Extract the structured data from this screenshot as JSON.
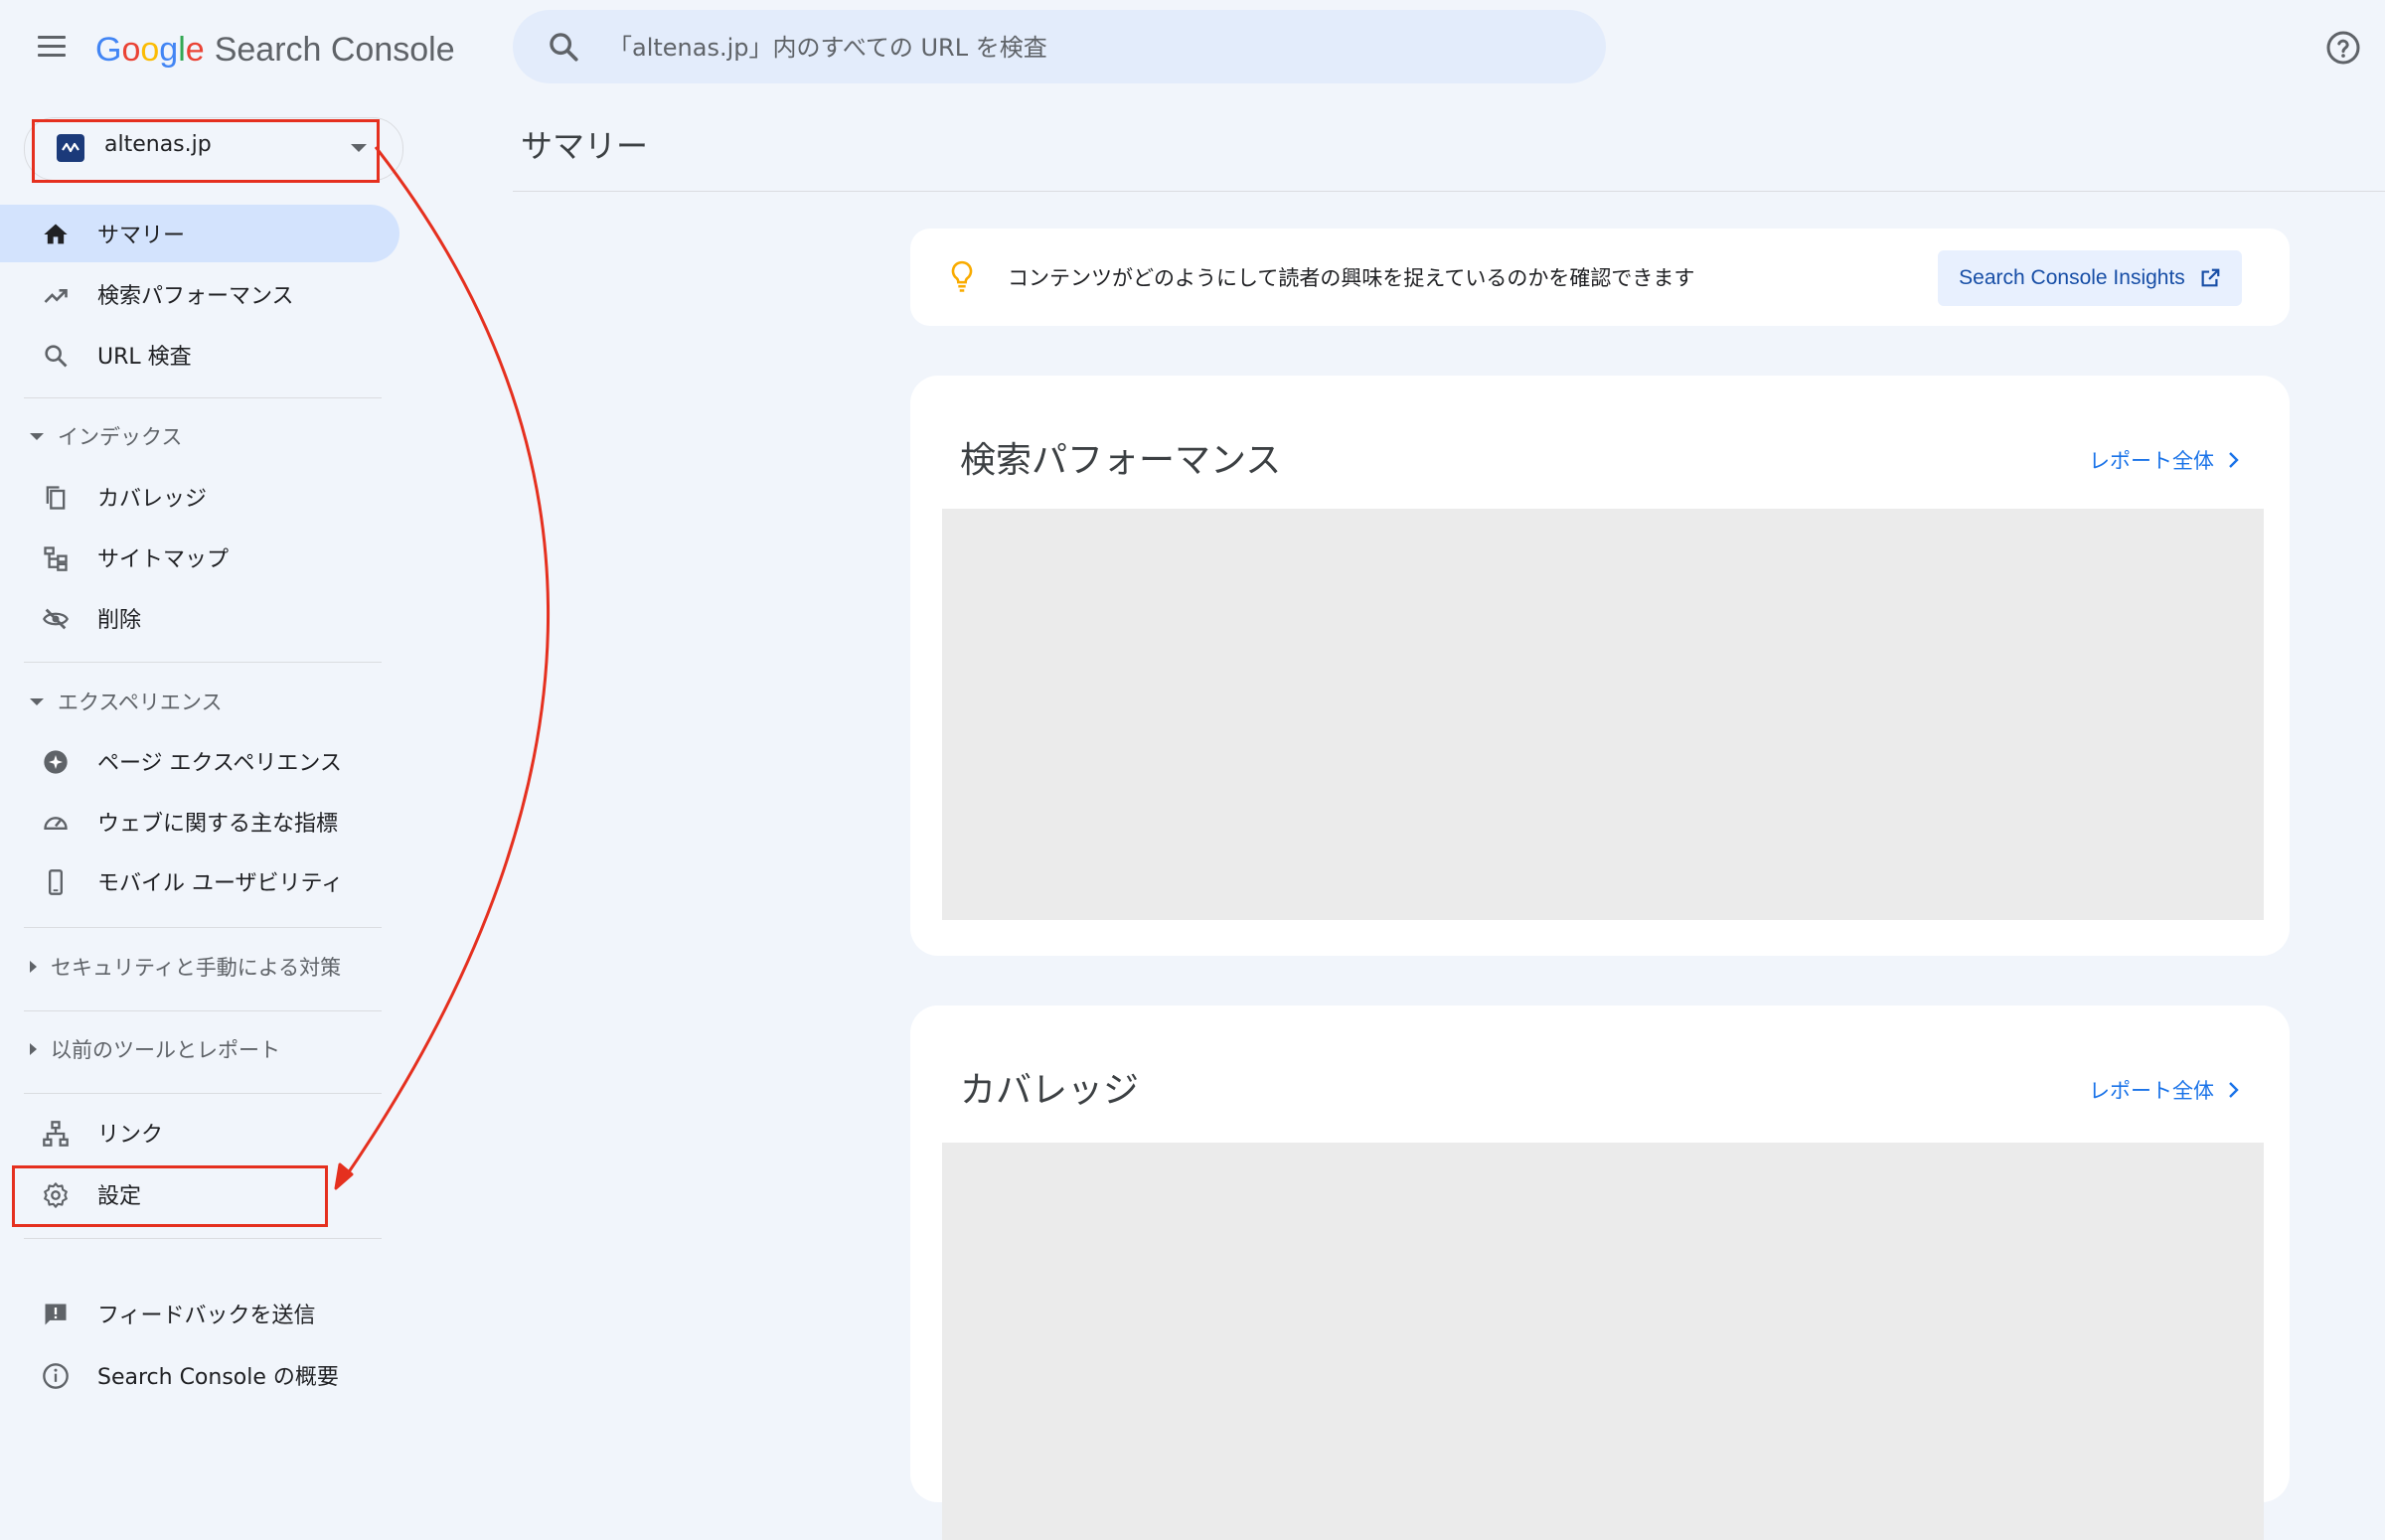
{
  "header": {
    "logo_google_letters": [
      "G",
      "o",
      "o",
      "g",
      "l",
      "e"
    ],
    "product_name": "Search Console",
    "search_placeholder": "「altenas.jp」内のすべての URL を検査"
  },
  "property": {
    "name": "altenas.jp"
  },
  "sidebar": {
    "items_top": [
      {
        "label": "サマリー",
        "icon": "home-icon",
        "active": true
      },
      {
        "label": "検索パフォーマンス",
        "icon": "trending-up-icon"
      },
      {
        "label": "URL 検査",
        "icon": "search-icon"
      }
    ],
    "section_index": {
      "label": "インデックス",
      "expanded": true,
      "items": [
        {
          "label": "カバレッジ",
          "icon": "copy-pages-icon"
        },
        {
          "label": "サイトマップ",
          "icon": "sitemap-icon"
        },
        {
          "label": "削除",
          "icon": "visibility-off-icon"
        }
      ]
    },
    "section_experience": {
      "label": "エクスペリエンス",
      "expanded": true,
      "items": [
        {
          "label": "ページ エクスペリエンス",
          "icon": "page-experience-icon"
        },
        {
          "label": "ウェブに関する主な指標",
          "icon": "speed-gauge-icon"
        },
        {
          "label": "モバイル ユーザビリティ",
          "icon": "smartphone-icon"
        }
      ]
    },
    "section_security": {
      "label": "セキュリティと手動による対策",
      "expanded": false
    },
    "section_legacy": {
      "label": "以前のツールとレポート",
      "expanded": false
    },
    "items_bottom": [
      {
        "label": "リンク",
        "icon": "links-icon"
      },
      {
        "label": "設定",
        "icon": "gear-icon"
      }
    ],
    "items_footer": [
      {
        "label": "フィードバックを送信",
        "icon": "feedback-icon"
      },
      {
        "label": "Search Console の概要",
        "icon": "info-icon"
      }
    ]
  },
  "main": {
    "page_title": "サマリー",
    "insights": {
      "text": "コンテンツがどのようにして読者の興味を捉えているのかを確認できます",
      "button_label": "Search Console Insights"
    },
    "cards": [
      {
        "title": "検索パフォーマンス",
        "link_label": "レポート全体"
      },
      {
        "title": "カバレッジ",
        "link_label": "レポート全体"
      }
    ]
  },
  "colors": {
    "background": "#f1f5fb",
    "active_nav": "#d3e3fd",
    "link": "#1a73e8",
    "annotation_red": "#e5301f"
  }
}
